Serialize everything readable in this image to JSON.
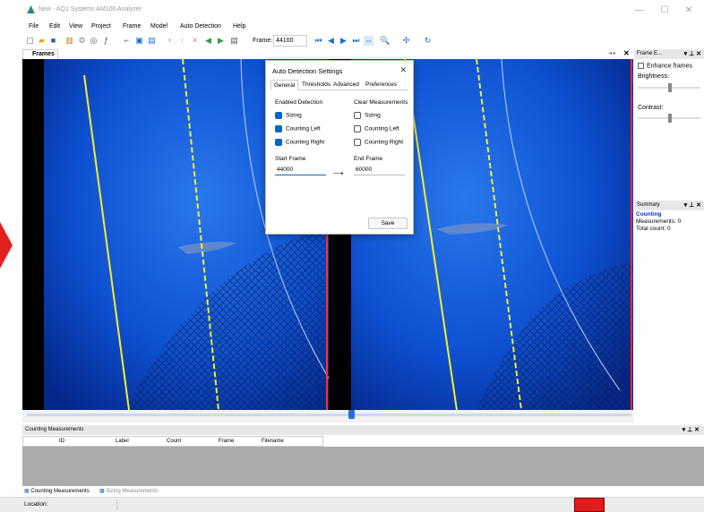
{
  "window": {
    "title": "New - AQ1 Systems AM100 Analyzer",
    "controls": {
      "minimize": "—",
      "maximize": "☐",
      "close": "✕"
    }
  },
  "menu": [
    "File",
    "Edit",
    "View",
    "Project",
    "Frame",
    "Model",
    "Auto Detection",
    "Help"
  ],
  "toolbar": {
    "frame_label": "Frame:",
    "frame_value": "44100"
  },
  "frames_tab": {
    "label": "Frames"
  },
  "dialog": {
    "title": "Auto Detection Settings",
    "close": "✕",
    "tabs": [
      "General",
      "Thresholds",
      "Advanced",
      "Preferences"
    ],
    "active_tab": "General",
    "enabled_detection": {
      "heading": "Enabled Detection",
      "items": [
        {
          "label": "Sizing",
          "checked": true
        },
        {
          "label": "Counting Left",
          "checked": true
        },
        {
          "label": "Counting Right",
          "checked": true
        }
      ]
    },
    "clear_measurements": {
      "heading": "Clear Measurements",
      "items": [
        {
          "label": "Sizing",
          "checked": false
        },
        {
          "label": "Counting Left",
          "checked": false
        },
        {
          "label": "Counting Right",
          "checked": false
        }
      ]
    },
    "start_frame": {
      "label": "Start Frame",
      "value": "44000"
    },
    "end_frame": {
      "label": "End Frame",
      "value": "60000"
    },
    "arrow": "⟶",
    "save_label": "Save"
  },
  "frame_panel": {
    "title": "Frame E...",
    "enhance_label": "Enhance frames",
    "brightness_label": "Brightness:",
    "contrast_label": "Contrast:"
  },
  "summary_panel": {
    "title": "Summary",
    "heading": "Counting",
    "measurements": "Measurements: 0",
    "total": "Total count: 0"
  },
  "counting_panel": {
    "title": "Counting Measurements",
    "columns": [
      "ID",
      "Label",
      "Count",
      "Frame",
      "Filename"
    ]
  },
  "bottom_tabs": [
    "Counting Measurements",
    "Sizing Measurements"
  ],
  "status": {
    "location_label": "Location:"
  },
  "colors": {
    "accent": "#0a63c9",
    "water": "#0b4fc8",
    "marker_red": "#e11b1b"
  },
  "icons": [
    "app-logo-icon",
    "new-file-icon",
    "open-folder-icon",
    "save-icon",
    "play-icon",
    "first-frame-icon",
    "prev-frame-icon",
    "next-frame-icon",
    "last-frame-icon",
    "zoom-icon",
    "close-icon",
    "pin-icon"
  ]
}
